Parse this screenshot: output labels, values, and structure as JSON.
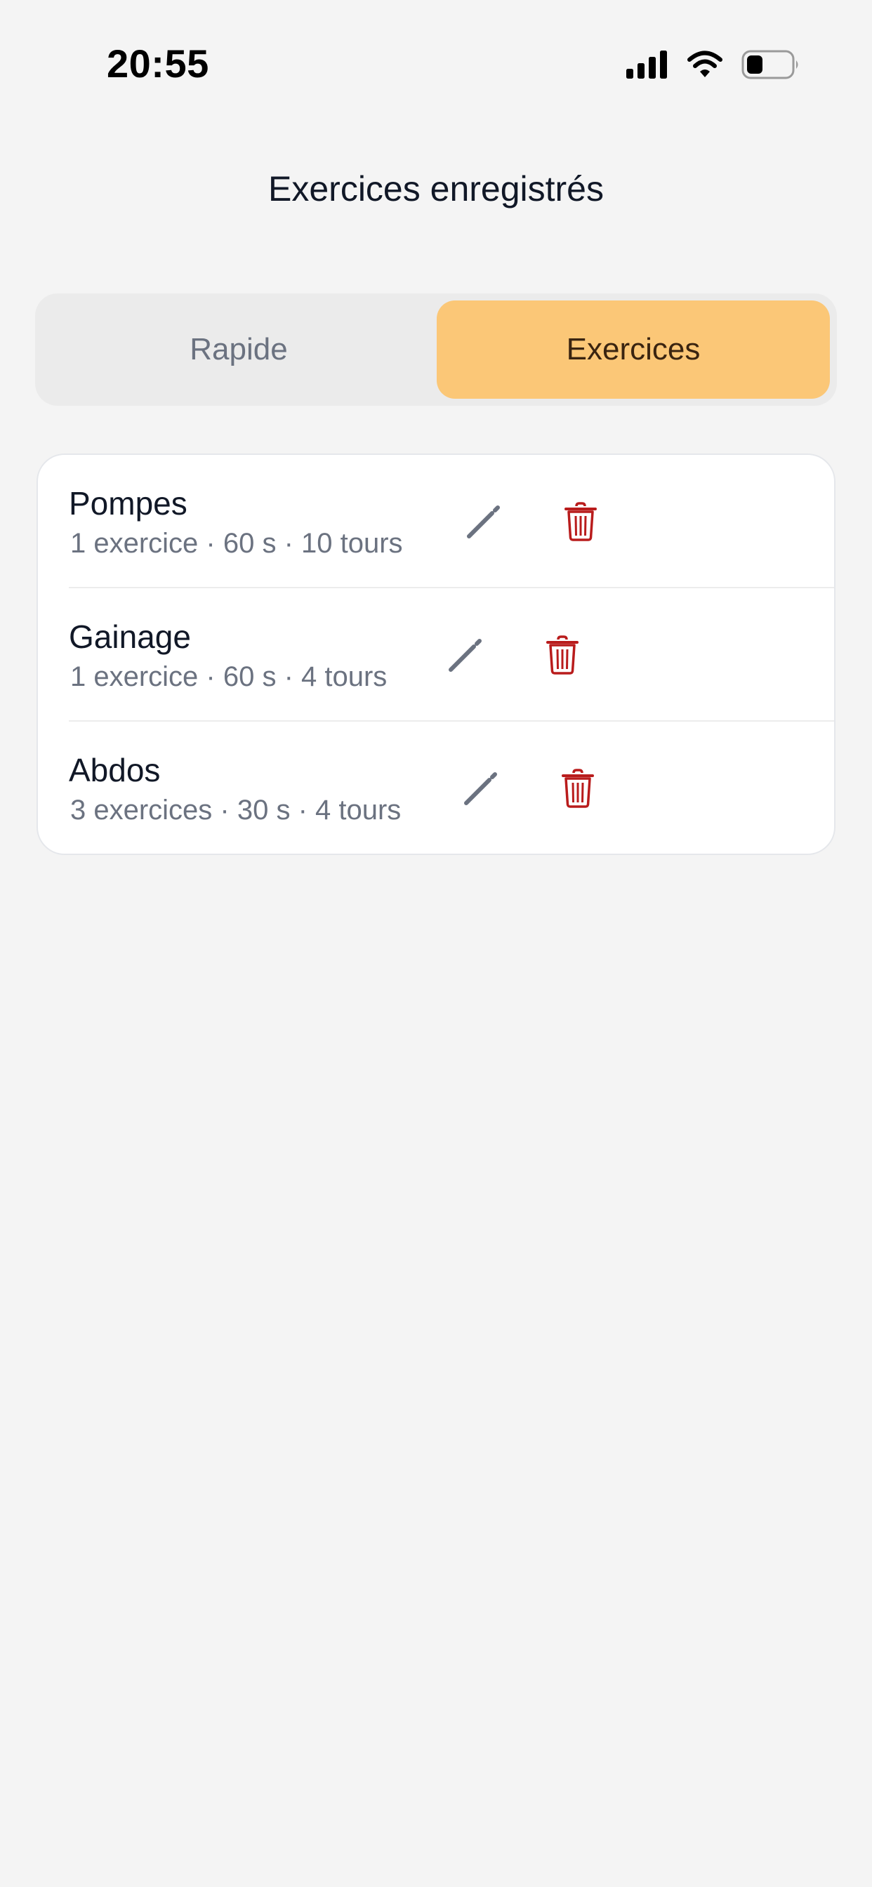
{
  "status_bar": {
    "time": "20:55",
    "icons": [
      "signal-icon",
      "wifi-icon",
      "battery-icon"
    ]
  },
  "page": {
    "title": "Exercices enregistrés"
  },
  "segmented": {
    "options": [
      "Rapide",
      "Exercices"
    ],
    "selected": "Exercices"
  },
  "workouts": [
    {
      "name": "Pompes",
      "details": "1 exercice · 60 s · 10 tours"
    },
    {
      "name": "Gainage",
      "details": "1 exercice · 60 s · 4 tours"
    },
    {
      "name": "Abdos",
      "details": "3 exercices · 30 s · 4 tours"
    }
  ],
  "colors": {
    "background": "#F4F4F4",
    "accent": "#FBC777",
    "delete": "#B91C1C",
    "edit": "#6B7280"
  },
  "icons": {
    "edit": "pencil-icon",
    "delete": "trash-icon"
  }
}
